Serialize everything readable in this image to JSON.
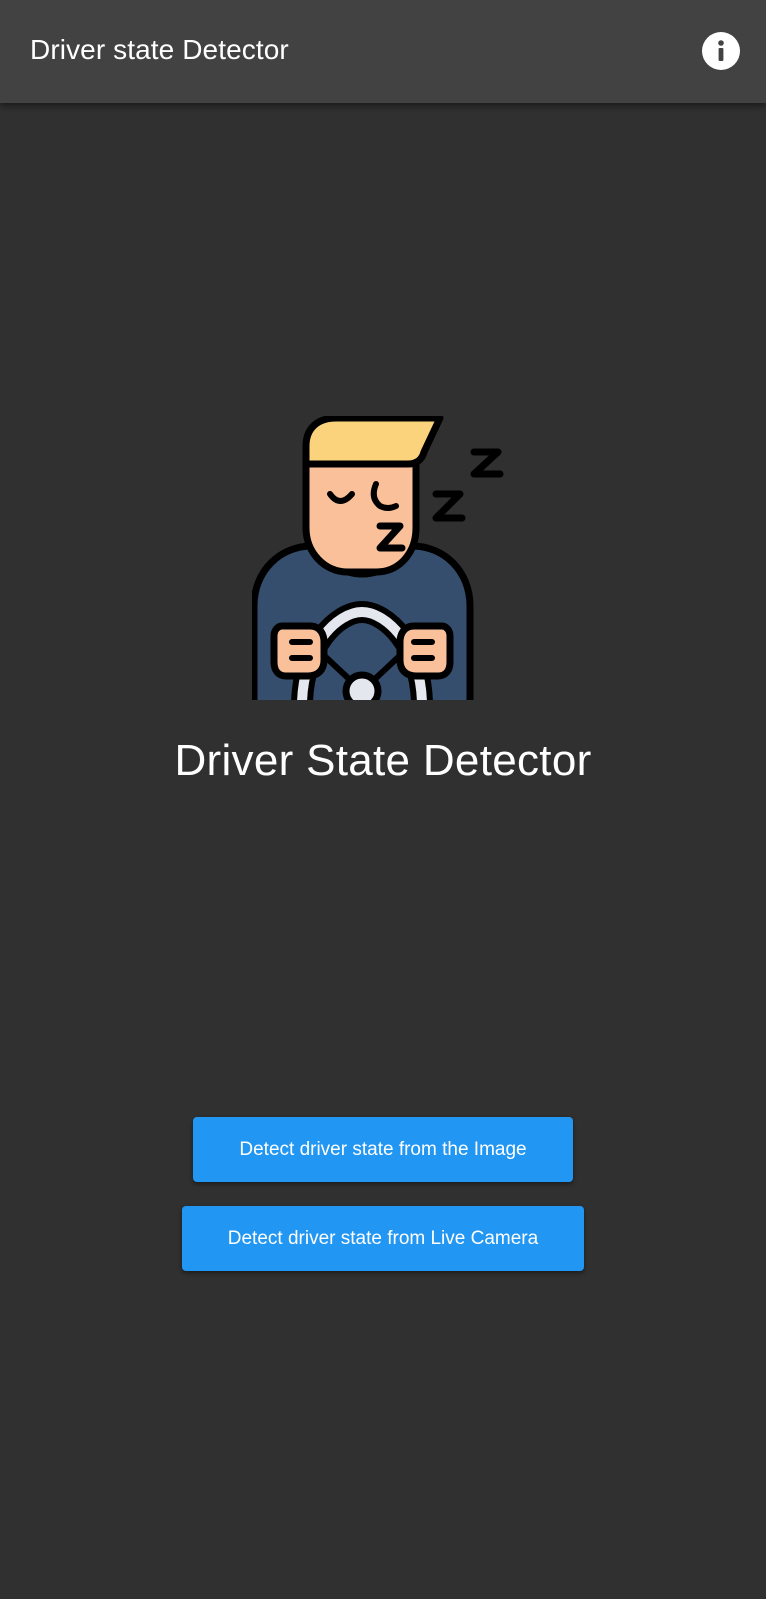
{
  "appbar": {
    "title": "Driver state Detector",
    "info_icon": "info-icon"
  },
  "hero": {
    "illustration": "sleeping-driver-illustration",
    "title": "Driver State Detector"
  },
  "actions": {
    "image_button_label": "Detect driver state from the Image",
    "camera_button_label": "Detect driver state from Live Camera"
  },
  "colors": {
    "background": "#303030",
    "appbar": "#424242",
    "accent": "#2196f3",
    "hair": "#fcd37d",
    "skin": "#f9c09a",
    "shirt": "#364e6d",
    "wheel": "#e4e7ee"
  }
}
